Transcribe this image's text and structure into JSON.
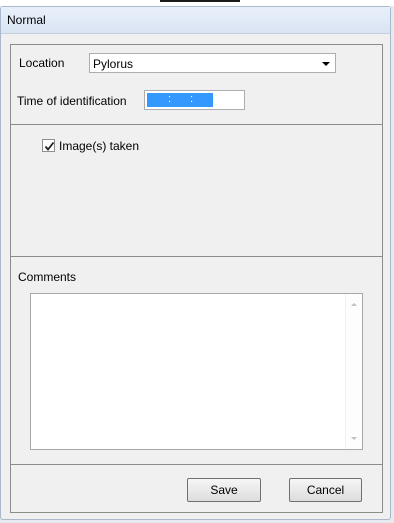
{
  "window": {
    "title": "Normal"
  },
  "location": {
    "label": "Location",
    "value": "Pylorus"
  },
  "time": {
    "label": "Time of identification",
    "separator": ":"
  },
  "images": {
    "label": "Image(s) taken",
    "checked": true
  },
  "comments": {
    "label": "Comments",
    "value": ""
  },
  "actions": {
    "save_label": "Save",
    "cancel_label": "Cancel"
  },
  "colors": {
    "selection": "#3399ff",
    "titlebar": "#dae4f2",
    "border": "#8c8c8c"
  },
  "icons": {
    "dropdown": "chevron-down-icon",
    "check": "checkmark-icon",
    "scroll_up": "scroll-up-arrow-icon",
    "scroll_down": "scroll-down-arrow-icon"
  }
}
